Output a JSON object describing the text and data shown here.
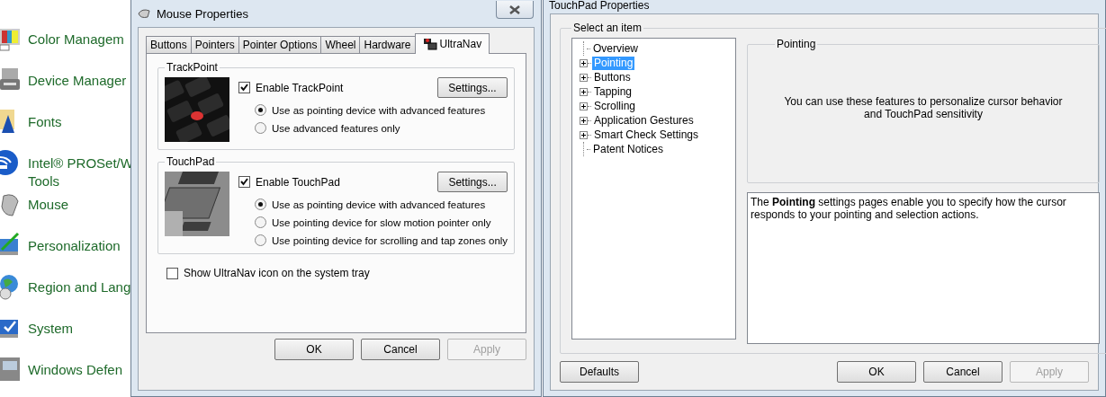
{
  "control_panel": {
    "items": [
      {
        "lines": [
          "Color Managem"
        ]
      },
      {
        "lines": [
          "Device Manager"
        ]
      },
      {
        "lines": [
          "Fonts"
        ]
      },
      {
        "lines": [
          "Intel® PROSet/W",
          "Tools"
        ]
      },
      {
        "lines": [
          "Mouse"
        ]
      },
      {
        "lines": [
          "Personalization"
        ]
      },
      {
        "lines": [
          "Region and Lang"
        ]
      },
      {
        "lines": [
          "System"
        ]
      },
      {
        "lines": [
          "Windows Defen"
        ]
      }
    ]
  },
  "mouse_properties": {
    "title": "Mouse Properties",
    "tabs": [
      {
        "label": "Buttons",
        "selected": false
      },
      {
        "label": "Pointers",
        "selected": false
      },
      {
        "label": "Pointer Options",
        "selected": false
      },
      {
        "label": "Wheel",
        "selected": false
      },
      {
        "label": "Hardware",
        "selected": false
      },
      {
        "label": "UltraNav",
        "selected": true
      }
    ],
    "groups": [
      {
        "title": "TrackPoint",
        "kind": "trackpoint",
        "enable": {
          "label": "Enable TrackPoint",
          "checked": true
        },
        "settings_button": "Settings...",
        "options": [
          {
            "label": "Use as pointing device with advanced features",
            "selected": true
          },
          {
            "label": "Use advanced features only",
            "selected": false
          }
        ]
      },
      {
        "title": "TouchPad",
        "kind": "touchpad",
        "enable": {
          "label": "Enable TouchPad",
          "checked": true
        },
        "settings_button": "Settings...",
        "options": [
          {
            "label": "Use as pointing device with advanced features",
            "selected": true
          },
          {
            "label": "Use pointing device for slow motion pointer only",
            "selected": false
          },
          {
            "label": "Use pointing device for scrolling and tap zones only",
            "selected": false
          }
        ]
      }
    ],
    "tray_checkbox": {
      "label": "Show UltraNav icon on the system tray",
      "checked": false
    },
    "buttons": [
      {
        "label": "OK",
        "disabled": false
      },
      {
        "label": "Cancel",
        "disabled": false
      },
      {
        "label": "Apply",
        "disabled": true
      }
    ]
  },
  "touchpad_properties": {
    "title": "TouchPad Properties",
    "group_title": "Select an item",
    "tree": [
      {
        "label": "Overview",
        "expandable": false,
        "selected": false
      },
      {
        "label": "Pointing",
        "expandable": true,
        "selected": true
      },
      {
        "label": "Buttons",
        "expandable": true,
        "selected": false
      },
      {
        "label": "Tapping",
        "expandable": true,
        "selected": false
      },
      {
        "label": "Scrolling",
        "expandable": true,
        "selected": false
      },
      {
        "label": "Application Gestures",
        "expandable": true,
        "selected": false
      },
      {
        "label": "Smart Check Settings",
        "expandable": true,
        "selected": false
      },
      {
        "label": "Patent Notices",
        "expandable": false,
        "selected": false
      }
    ],
    "panel": {
      "title": "Pointing",
      "text": "You can use these features to personalize cursor behavior and TouchPad sensitivity"
    },
    "description": "The **Pointing** settings pages enable you to specify how the cursor responds to your pointing and selection actions.",
    "defaults_button": "Defaults",
    "buttons": [
      {
        "label": "OK",
        "disabled": false
      },
      {
        "label": "Cancel",
        "disabled": false
      },
      {
        "label": "Apply",
        "disabled": true
      }
    ]
  }
}
